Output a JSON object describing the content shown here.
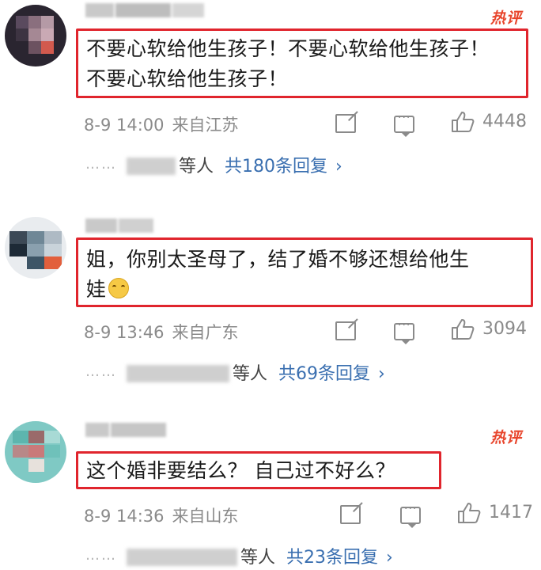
{
  "comments": [
    {
      "hot_badge": "热评",
      "text_lines": [
        "不要心软给他生孩子！不要心软给他生孩子！",
        "不要心软给他生孩子！"
      ],
      "date_time": "8-9 14:00",
      "location": "来自江苏",
      "likes": "4448",
      "replies_suffix": "等人",
      "replies_count": "共180条回复",
      "replies_chevron": "›"
    },
    {
      "hot_badge": "",
      "text_lines": [
        "姐，你别太圣母了，结了婚不够还想给他生",
        "娃"
      ],
      "date_time": "8-9 13:46",
      "location": "来自广东",
      "likes": "3094",
      "replies_suffix": "等人",
      "replies_count": "共69条回复",
      "replies_chevron": "›"
    },
    {
      "hot_badge": "热评",
      "text_lines": [
        "这个婚非要结么？ 自己过不好么？"
      ],
      "date_time": "8-9 14:36",
      "location": "来自山东",
      "likes": "1417",
      "replies_suffix": "等人",
      "replies_count": "共23条回复",
      "replies_chevron": "›"
    }
  ],
  "reply_dots": "……",
  "colors": {
    "highlight_border": "#e0252d",
    "hot_badge": "#e8452c",
    "link": "#3a6fb0",
    "meta": "#8a8a8a"
  },
  "icons": [
    "share-icon",
    "comment-icon",
    "like-icon",
    "laughing-crying-emoji"
  ]
}
